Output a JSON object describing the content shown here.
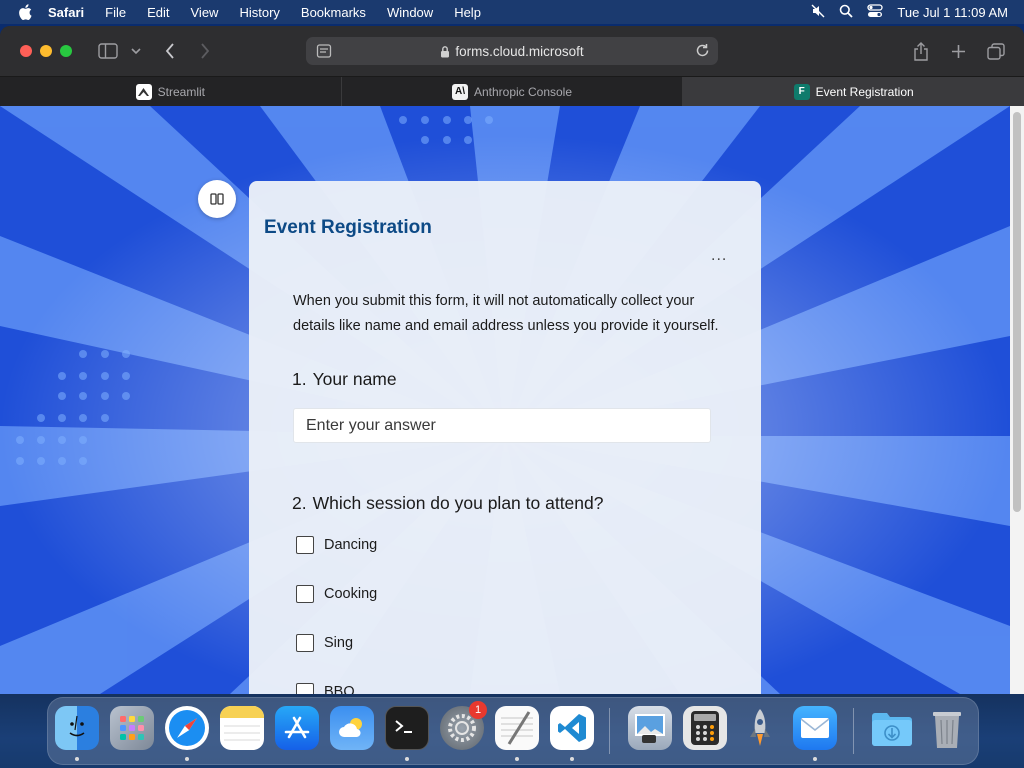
{
  "menubar": {
    "app_name": "Safari",
    "items": [
      "File",
      "Edit",
      "View",
      "History",
      "Bookmarks",
      "Window",
      "Help"
    ],
    "clock": "Tue Jul 1  11:09 AM"
  },
  "browser": {
    "url": "forms.cloud.microsoft",
    "tabs": [
      {
        "label": "Streamlit",
        "active": false
      },
      {
        "label": "Anthropic Console",
        "active": false
      },
      {
        "label": "Event Registration",
        "active": true
      }
    ]
  },
  "form": {
    "title": "Event Registration",
    "more_label": "...",
    "notice": "When you submit this form, it will not automatically collect your details like name and email address unless you provide it yourself.",
    "q1": {
      "number": "1.",
      "text": "Your name",
      "placeholder": "Enter your answer"
    },
    "q2": {
      "number": "2.",
      "text": "Which session do you plan to attend?",
      "options": [
        "Dancing",
        "Cooking",
        "Sing",
        "BBQ"
      ]
    }
  },
  "dock": {
    "apps": [
      "Finder",
      "Launchpad",
      "Safari",
      "Notes",
      "App Store",
      "Weather",
      "Terminal",
      "System Settings",
      "TextEdit",
      "Visual Studio Code",
      "Preview",
      "Calculator",
      "Rocket",
      "Mail",
      "Downloads",
      "Trash"
    ],
    "settings_badge": "1"
  },
  "colors": {
    "form_title": "#0d4a86",
    "page_bg": "#1f4fd8",
    "traffic_red": "#fe5f57",
    "traffic_yellow": "#febc2e",
    "traffic_green": "#28c840"
  }
}
